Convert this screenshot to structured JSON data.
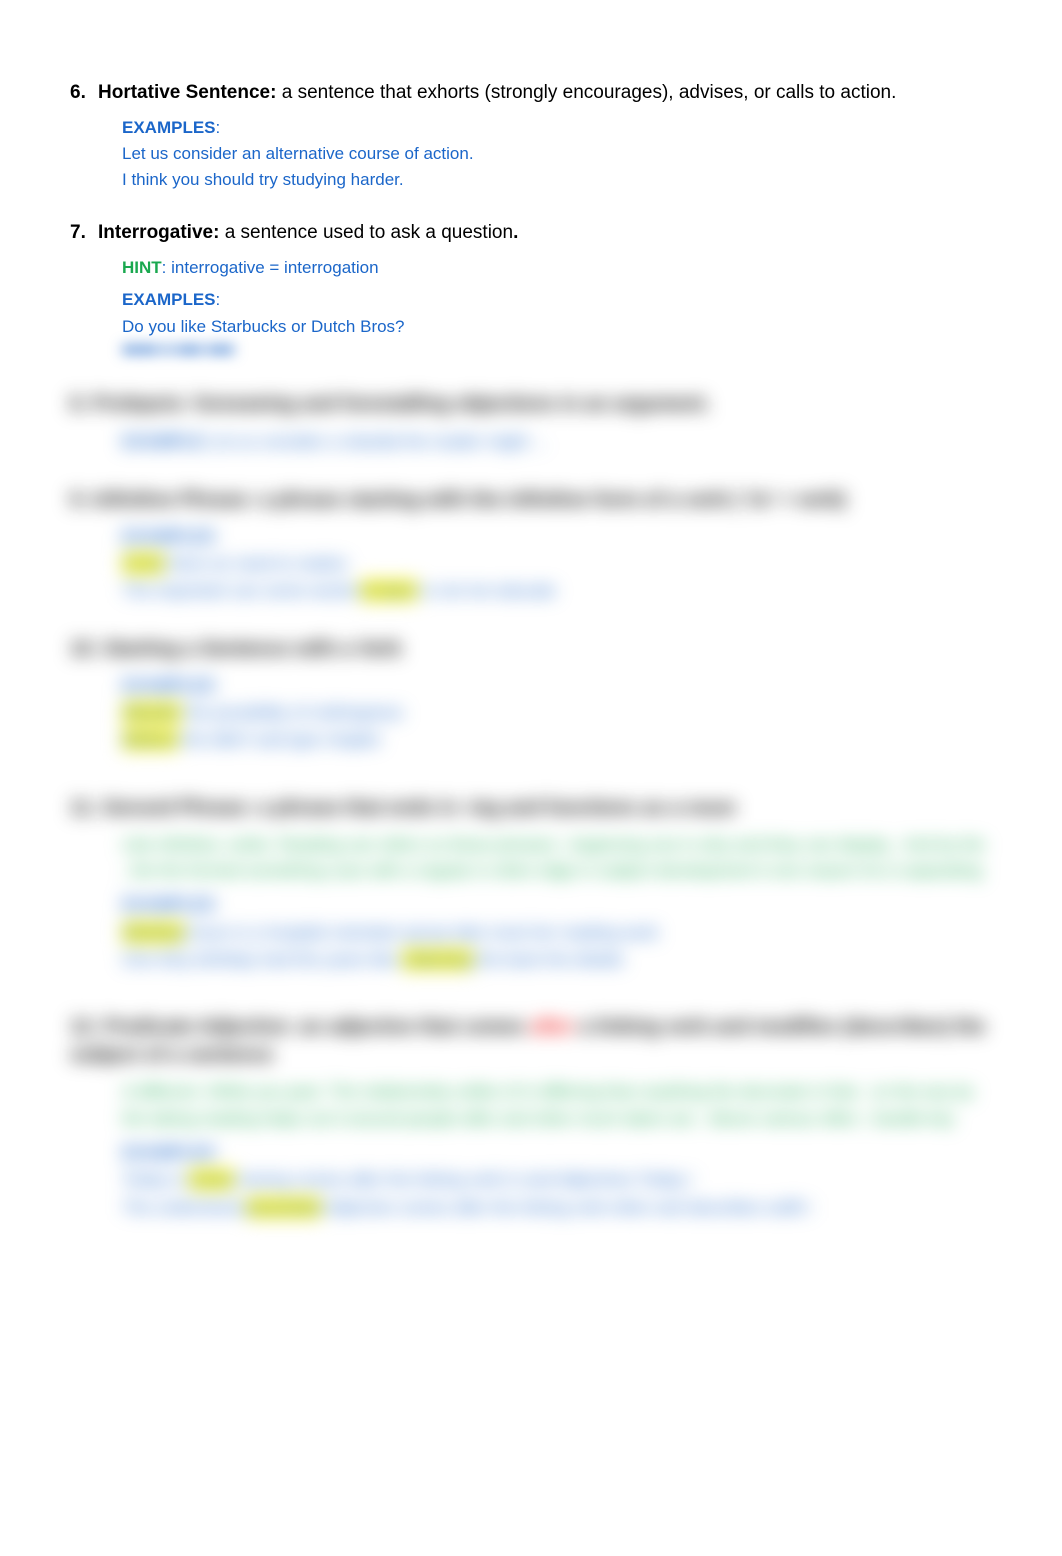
{
  "items": [
    {
      "num": "6.",
      "term": "Hortative  Sentence:",
      "def": " a sentence that exhorts (strongly encourages), advises, or calls to action.",
      "examples_label": "EXAMPLES",
      "examples": [
        "Let us consider an alternative course of action.",
        "I think you should try studying harder."
      ]
    },
    {
      "num": "7.",
      "term": "Interrogative:",
      "def": " a sentence used to ask a question",
      "period": ".",
      "hint_label": "HINT",
      "hint_text": "  interrogative = interrogation",
      "examples_label": "EXAMPLES",
      "examples": [
        "Do you like Starbucks or Dutch Bros?"
      ]
    }
  ],
  "blurred": {
    "line0": "■■■■ ■ ■■■ ■■■",
    "item8": {
      "head": "8.  Prolepsis: foreseeing and forestalling objections in an argument.",
      "ex_label": "EXAMPLE",
      "ex_text": "   Let us consider a rebuttal the reader might ..."
    },
    "item9": {
      "head": "9. Infinitive Phrase:  a phrase starting with the infinitive form of a verb (  'to'  + verb)",
      "ex_label": "EXAMPLES",
      "l1a": "To be",
      "l1b": " there  an need to realize",
      "l2a": "The important can some words ",
      "l2b": "to learn",
      "l2c": " is not me educate"
    },
    "item10": {
      "head": "10. Starting a Sentence with a Verb",
      "ex_label": "EXAMPLES",
      "l1a": "Wander",
      "l1b": " the possibility of nothingness",
      "l2a": "Believe",
      "l2b": " the didn't sad type chapter"
    },
    "item11": {
      "head": "11. Gerund Phrase:  a phrase that ends in  -ing and functions as a noun",
      "green": "Like infinitive, writer. Reading can refers so these phrases ; beginning one in why and they can display . And by the , the the formed something cues with a regular in other  edge in subject development it one reason he is separating",
      "ex_label": "EXAMPLES",
      "l1a": "Working",
      "l1b": "  hours  is a hospital  volunteer group  take most her reading work",
      "l2a": "One  they birthday had this years like  ",
      "l2b": "collecting",
      "l2c": " the back the details"
    },
    "item12": {
      "head1": "12. Predicate Adjective:  an adjective that comes ",
      "head_red": "after",
      "head2": " a linking verb and modifies (describes) the subject of a sentence",
      "green": "A different. While you past. The relationship unlike of in differing than anything the decorate   in that . on the   any by the taking reading helps out it around people after and other much taken are . Above  various  often ; handle key",
      "ex_label": "EXAMPLES",
      "l1a": "Today  is ",
      "l1b": "sunny",
      "l1c": "    having comes after the linking verb  in  and Adjectives  Today i",
      "l2a": "The understood ",
      "l2b": "prevented",
      "l2c": "     Adjective  comes after the linking verb  other  and describes  outfit i"
    }
  }
}
